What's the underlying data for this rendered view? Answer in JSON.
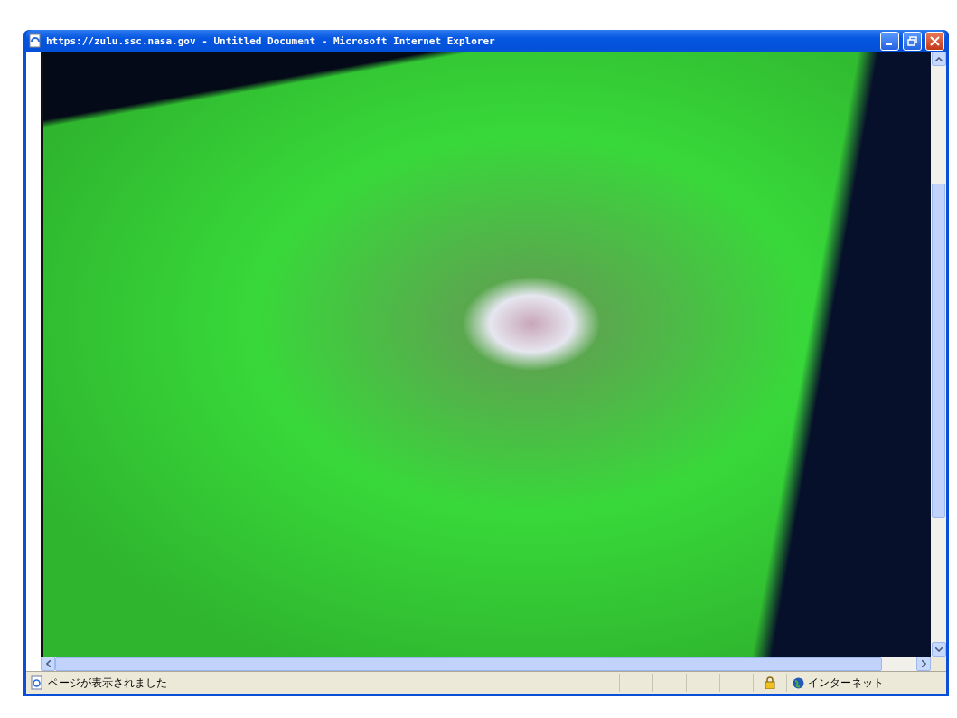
{
  "window": {
    "title": "https://zulu.ssc.nasa.gov - Untitled Document - Microsoft Internet Explorer"
  },
  "status_bar": {
    "message": "ページが表示されました",
    "zone": "インターネット"
  }
}
